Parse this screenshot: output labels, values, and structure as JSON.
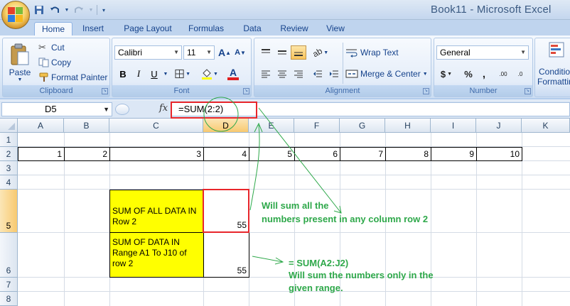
{
  "window": {
    "title": "Book11 - Microsoft Excel"
  },
  "ribbon": {
    "tabs": [
      {
        "id": "home",
        "label": "Home",
        "active": true
      },
      {
        "id": "insert",
        "label": "Insert"
      },
      {
        "id": "page-layout",
        "label": "Page Layout"
      },
      {
        "id": "formulas",
        "label": "Formulas"
      },
      {
        "id": "data",
        "label": "Data"
      },
      {
        "id": "review",
        "label": "Review"
      },
      {
        "id": "view",
        "label": "View"
      }
    ],
    "clipboard": {
      "label": "Clipboard",
      "paste": "Paste",
      "cut": "Cut",
      "copy": "Copy",
      "format_painter": "Format Painter"
    },
    "font": {
      "label": "Font",
      "name": "Calibri",
      "size": "11",
      "bold": "B",
      "italic": "I",
      "underline": "U",
      "grow": "A",
      "shrink": "A",
      "color_letter": "A"
    },
    "alignment": {
      "label": "Alignment",
      "wrap_text": "Wrap Text",
      "merge_center": "Merge & Center"
    },
    "number": {
      "label": "Number",
      "format": "General",
      "currency": "$",
      "percent": "%",
      "comma": ",",
      "inc_decimal": ".00",
      "dec_decimal": ".0"
    },
    "styles": {
      "conditional_formatting_1": "Conditio",
      "conditional_formatting_2": "Formattin"
    }
  },
  "formula_bar": {
    "name_box": "D5",
    "fx": "fx",
    "formula": "=SUM(2:2)"
  },
  "sheet": {
    "columns": [
      "A",
      "B",
      "C",
      "D",
      "E",
      "F",
      "G",
      "H",
      "I",
      "J",
      "K"
    ],
    "selected_column": "D",
    "rows": [
      "1",
      "2",
      "3",
      "4",
      "5",
      "6",
      "7",
      "8"
    ],
    "selected_row": "5",
    "row2_values": [
      "1",
      "2",
      "3",
      "4",
      "5",
      "6",
      "7",
      "8",
      "9",
      "10"
    ],
    "c5_line1": "SUM OF ALL DATA IN",
    "c5_line2": "Row 2",
    "d5": "55",
    "c6_line1": "SUM OF DATA IN",
    "c6_line2": "Range A1 To J10 of",
    "c6_line3": "row 2",
    "d6": "55"
  },
  "annotations": {
    "note1_line1": "Will sum all the",
    "note1_line2": "numbers present in any column  row 2",
    "note2_line1": "= SUM(A2:J2)",
    "note2_line2": "Will sum the numbers only in the",
    "note2_line3": "given range.",
    "highlight_color": "#e8262b",
    "note_color": "#2ea84a",
    "cell_fill": "#ffff00"
  }
}
